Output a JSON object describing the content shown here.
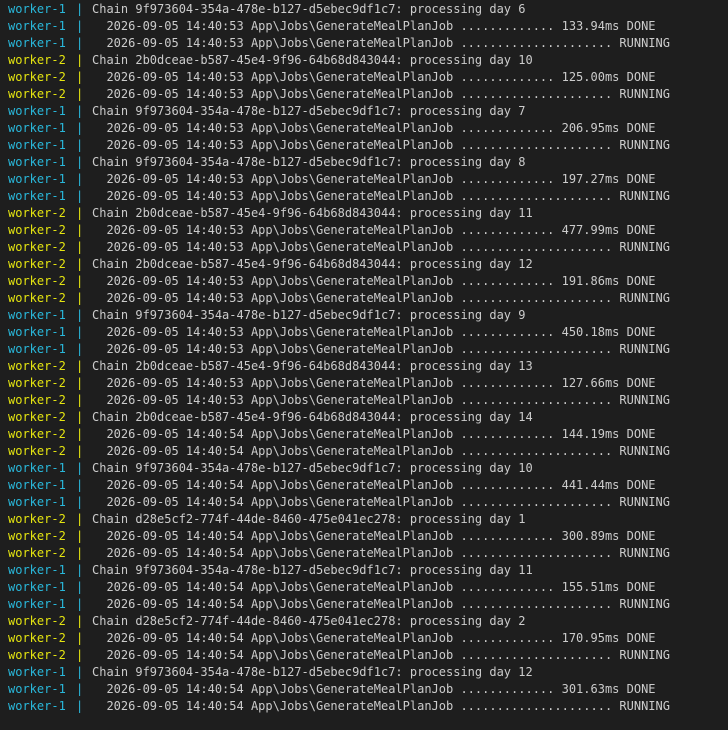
{
  "colors": {
    "background": "#1e1e1e",
    "text": "#cccccc",
    "worker-1": "#29b8db",
    "worker-2": "#e5e510"
  },
  "lines": [
    {
      "worker": "worker-1",
      "text": "Chain 9f973604-354a-478e-b127-d5ebec9df1c7: processing day 6"
    },
    {
      "worker": "worker-1",
      "text": "  2026-09-05 14:40:53 App\\Jobs\\GenerateMealPlanJob ............. 133.94ms DONE"
    },
    {
      "worker": "worker-1",
      "text": "  2026-09-05 14:40:53 App\\Jobs\\GenerateMealPlanJob ..................... RUNNING"
    },
    {
      "worker": "worker-2",
      "text": "Chain 2b0dceae-b587-45e4-9f96-64b68d843044: processing day 10"
    },
    {
      "worker": "worker-2",
      "text": "  2026-09-05 14:40:53 App\\Jobs\\GenerateMealPlanJob ............. 125.00ms DONE"
    },
    {
      "worker": "worker-2",
      "text": "  2026-09-05 14:40:53 App\\Jobs\\GenerateMealPlanJob ..................... RUNNING"
    },
    {
      "worker": "worker-1",
      "text": "Chain 9f973604-354a-478e-b127-d5ebec9df1c7: processing day 7"
    },
    {
      "worker": "worker-1",
      "text": "  2026-09-05 14:40:53 App\\Jobs\\GenerateMealPlanJob ............. 206.95ms DONE"
    },
    {
      "worker": "worker-1",
      "text": "  2026-09-05 14:40:53 App\\Jobs\\GenerateMealPlanJob ..................... RUNNING"
    },
    {
      "worker": "worker-1",
      "text": "Chain 9f973604-354a-478e-b127-d5ebec9df1c7: processing day 8"
    },
    {
      "worker": "worker-1",
      "text": "  2026-09-05 14:40:53 App\\Jobs\\GenerateMealPlanJob ............. 197.27ms DONE"
    },
    {
      "worker": "worker-1",
      "text": "  2026-09-05 14:40:53 App\\Jobs\\GenerateMealPlanJob ..................... RUNNING"
    },
    {
      "worker": "worker-2",
      "text": "Chain 2b0dceae-b587-45e4-9f96-64b68d843044: processing day 11"
    },
    {
      "worker": "worker-2",
      "text": "  2026-09-05 14:40:53 App\\Jobs\\GenerateMealPlanJob ............. 477.99ms DONE"
    },
    {
      "worker": "worker-2",
      "text": "  2026-09-05 14:40:53 App\\Jobs\\GenerateMealPlanJob ..................... RUNNING"
    },
    {
      "worker": "worker-2",
      "text": "Chain 2b0dceae-b587-45e4-9f96-64b68d843044: processing day 12"
    },
    {
      "worker": "worker-2",
      "text": "  2026-09-05 14:40:53 App\\Jobs\\GenerateMealPlanJob ............. 191.86ms DONE"
    },
    {
      "worker": "worker-2",
      "text": "  2026-09-05 14:40:53 App\\Jobs\\GenerateMealPlanJob ..................... RUNNING"
    },
    {
      "worker": "worker-1",
      "text": "Chain 9f973604-354a-478e-b127-d5ebec9df1c7: processing day 9"
    },
    {
      "worker": "worker-1",
      "text": "  2026-09-05 14:40:53 App\\Jobs\\GenerateMealPlanJob ............. 450.18ms DONE"
    },
    {
      "worker": "worker-1",
      "text": "  2026-09-05 14:40:53 App\\Jobs\\GenerateMealPlanJob ..................... RUNNING"
    },
    {
      "worker": "worker-2",
      "text": "Chain 2b0dceae-b587-45e4-9f96-64b68d843044: processing day 13"
    },
    {
      "worker": "worker-2",
      "text": "  2026-09-05 14:40:53 App\\Jobs\\GenerateMealPlanJob ............. 127.66ms DONE"
    },
    {
      "worker": "worker-2",
      "text": "  2026-09-05 14:40:53 App\\Jobs\\GenerateMealPlanJob ..................... RUNNING"
    },
    {
      "worker": "worker-2",
      "text": "Chain 2b0dceae-b587-45e4-9f96-64b68d843044: processing day 14"
    },
    {
      "worker": "worker-2",
      "text": "  2026-09-05 14:40:54 App\\Jobs\\GenerateMealPlanJob ............. 144.19ms DONE"
    },
    {
      "worker": "worker-2",
      "text": "  2026-09-05 14:40:54 App\\Jobs\\GenerateMealPlanJob ..................... RUNNING"
    },
    {
      "worker": "worker-1",
      "text": "Chain 9f973604-354a-478e-b127-d5ebec9df1c7: processing day 10"
    },
    {
      "worker": "worker-1",
      "text": "  2026-09-05 14:40:54 App\\Jobs\\GenerateMealPlanJob ............. 441.44ms DONE"
    },
    {
      "worker": "worker-1",
      "text": "  2026-09-05 14:40:54 App\\Jobs\\GenerateMealPlanJob ..................... RUNNING"
    },
    {
      "worker": "worker-2",
      "text": "Chain d28e5cf2-774f-44de-8460-475e041ec278: processing day 1"
    },
    {
      "worker": "worker-2",
      "text": "  2026-09-05 14:40:54 App\\Jobs\\GenerateMealPlanJob ............. 300.89ms DONE"
    },
    {
      "worker": "worker-2",
      "text": "  2026-09-05 14:40:54 App\\Jobs\\GenerateMealPlanJob ..................... RUNNING"
    },
    {
      "worker": "worker-1",
      "text": "Chain 9f973604-354a-478e-b127-d5ebec9df1c7: processing day 11"
    },
    {
      "worker": "worker-1",
      "text": "  2026-09-05 14:40:54 App\\Jobs\\GenerateMealPlanJob ............. 155.51ms DONE"
    },
    {
      "worker": "worker-1",
      "text": "  2026-09-05 14:40:54 App\\Jobs\\GenerateMealPlanJob ..................... RUNNING"
    },
    {
      "worker": "worker-2",
      "text": "Chain d28e5cf2-774f-44de-8460-475e041ec278: processing day 2"
    },
    {
      "worker": "worker-2",
      "text": "  2026-09-05 14:40:54 App\\Jobs\\GenerateMealPlanJob ............. 170.95ms DONE"
    },
    {
      "worker": "worker-2",
      "text": "  2026-09-05 14:40:54 App\\Jobs\\GenerateMealPlanJob ..................... RUNNING"
    },
    {
      "worker": "worker-1",
      "text": "Chain 9f973604-354a-478e-b127-d5ebec9df1c7: processing day 12"
    },
    {
      "worker": "worker-1",
      "text": "  2026-09-05 14:40:54 App\\Jobs\\GenerateMealPlanJob ............. 301.63ms DONE"
    },
    {
      "worker": "worker-1",
      "text": "  2026-09-05 14:40:54 App\\Jobs\\GenerateMealPlanJob ..................... RUNNING"
    }
  ]
}
